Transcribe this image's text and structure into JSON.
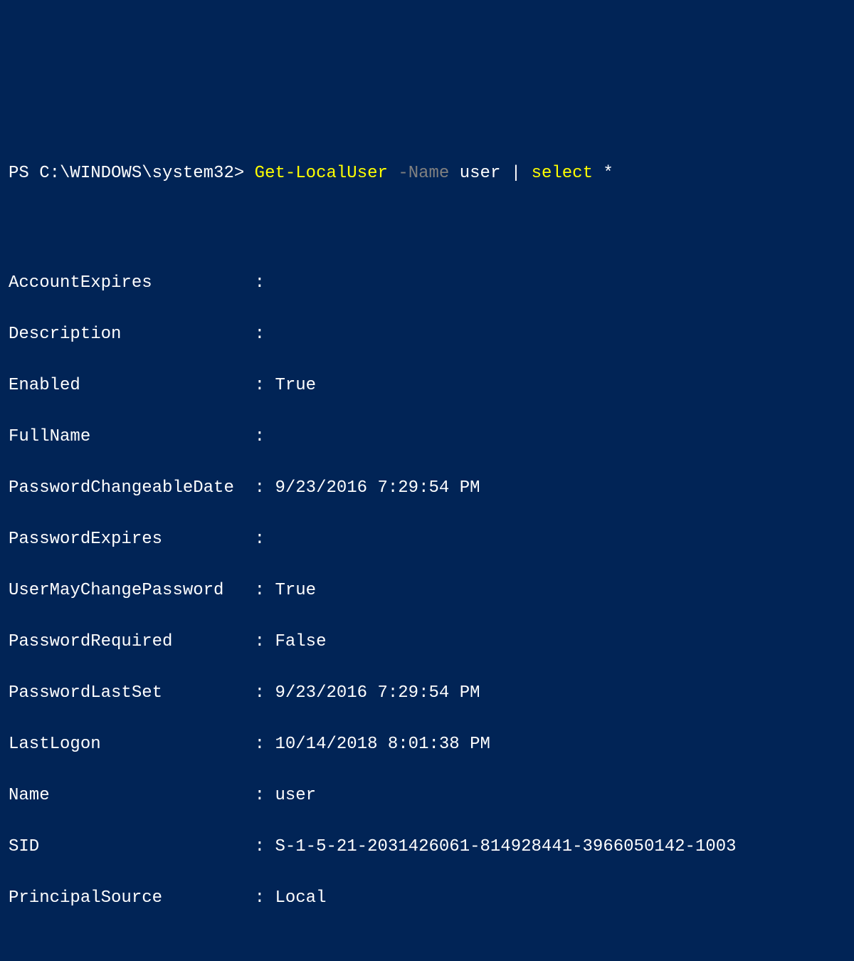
{
  "prompt": {
    "ps": "PS C:\\WINDOWS\\system32>",
    "cmdlet": "Get-LocalUser",
    "param": "-Name",
    "arg": "user",
    "pipe": "|",
    "select": "select",
    "star": "*"
  },
  "output": {
    "rows": [
      {
        "label": "AccountExpires",
        "value": ""
      },
      {
        "label": "Description",
        "value": ""
      },
      {
        "label": "Enabled",
        "value": "True"
      },
      {
        "label": "FullName",
        "value": ""
      },
      {
        "label": "PasswordChangeableDate",
        "value": "9/23/2016 7:29:54 PM"
      },
      {
        "label": "PasswordExpires",
        "value": ""
      },
      {
        "label": "UserMayChangePassword",
        "value": "True"
      },
      {
        "label": "PasswordRequired",
        "value": "False"
      },
      {
        "label": "PasswordLastSet",
        "value": "9/23/2016 7:29:54 PM"
      },
      {
        "label": "LastLogon",
        "value": "10/14/2018 8:01:38 PM"
      },
      {
        "label": "Name",
        "value": "user"
      },
      {
        "label": "SID",
        "value": "S-1-5-21-2031426061-814928441-3966050142-1003"
      },
      {
        "label": "PrincipalSource",
        "value": "Local"
      }
    ]
  }
}
